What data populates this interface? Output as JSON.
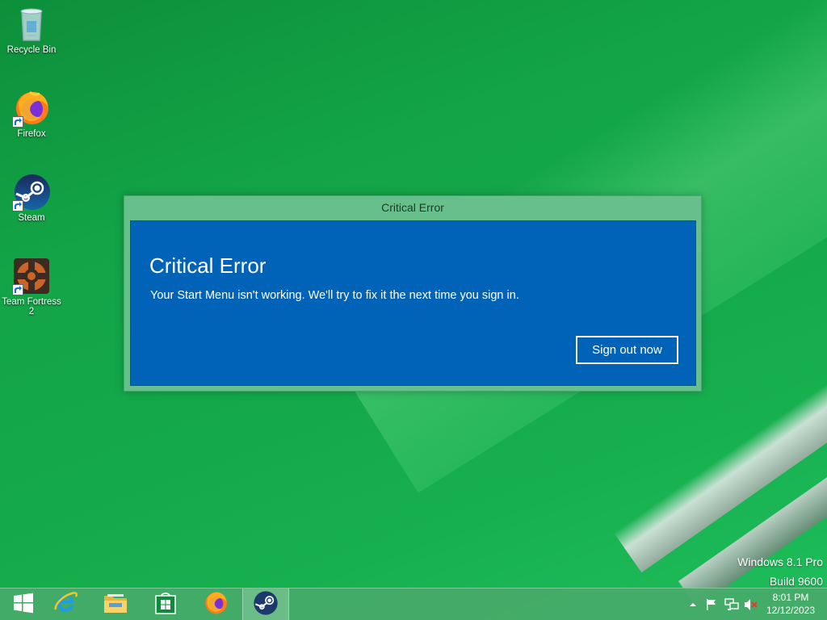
{
  "desktop": {
    "icons": [
      {
        "label": "Recycle Bin",
        "icon": "recycle-bin-icon"
      },
      {
        "label": "Firefox",
        "icon": "firefox-icon"
      },
      {
        "label": "Steam",
        "icon": "steam-icon"
      },
      {
        "label": "Team Fortress 2",
        "icon": "team-fortress-2-icon"
      }
    ]
  },
  "dialog": {
    "window_title": "Critical Error",
    "heading": "Critical Error",
    "message": "Your Start Menu isn't working. We'll try to fix it the next time you sign in.",
    "button_label": "Sign out now"
  },
  "watermark": {
    "line1": "Windows 8.1 Pro",
    "line2": "Build 9600"
  },
  "taskbar": {
    "items": [
      {
        "icon": "windows-start-icon",
        "name": "Start"
      },
      {
        "icon": "internet-explorer-icon",
        "name": "Internet Explorer"
      },
      {
        "icon": "file-explorer-icon",
        "name": "File Explorer"
      },
      {
        "icon": "windows-store-icon",
        "name": "Store"
      },
      {
        "icon": "firefox-icon",
        "name": "Firefox"
      },
      {
        "icon": "steam-icon",
        "name": "Steam",
        "active": true
      }
    ],
    "tray": {
      "icons": [
        "show-hidden-icons-chevron",
        "action-center-flag-icon",
        "network-icon",
        "volume-muted-icon"
      ],
      "time": "8:01 PM",
      "date": "12/12/2023"
    }
  },
  "colors": {
    "desktop_green": "#14a94a",
    "dialog_frame": "#67c08c",
    "dialog_body": "#0063b8",
    "taskbar": "#46aa69"
  }
}
